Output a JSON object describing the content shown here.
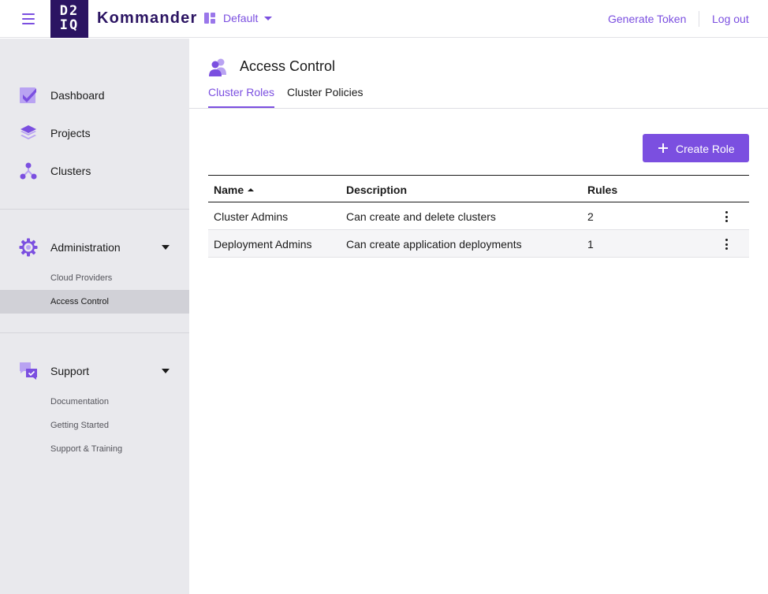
{
  "header": {
    "logo_line1": "D2",
    "logo_line2": "IQ",
    "app_name": "Kommander",
    "workspace": "Default",
    "generate_token": "Generate Token",
    "logout": "Log out"
  },
  "sidebar": {
    "items": [
      {
        "label": "Dashboard",
        "icon": "dashboard-icon"
      },
      {
        "label": "Projects",
        "icon": "projects-icon"
      },
      {
        "label": "Clusters",
        "icon": "clusters-icon"
      }
    ],
    "administration": {
      "label": "Administration",
      "icon": "gear-icon",
      "children": [
        "Cloud Providers",
        "Access Control"
      ],
      "active_child": "Access Control"
    },
    "support": {
      "label": "Support",
      "icon": "support-chat-icon",
      "children": [
        "Documentation",
        "Getting Started",
        "Support & Training"
      ]
    }
  },
  "main": {
    "title": "Access Control",
    "tabs": [
      {
        "label": "Cluster Roles",
        "active": true
      },
      {
        "label": "Cluster Policies",
        "active": false
      }
    ],
    "create_button": "Create Role",
    "table": {
      "columns": [
        "Name",
        "Description",
        "Rules"
      ],
      "sorted_by": "Name",
      "rows": [
        {
          "name": "Cluster Admins",
          "description": "Can create and delete clusters",
          "rules": "2"
        },
        {
          "name": "Deployment Admins",
          "description": "Can create application deployments",
          "rules": "1"
        }
      ]
    }
  },
  "colors": {
    "accent": "#7b4fe0",
    "brand_dark": "#2b1462",
    "sidebar_bg": "#e9e9ed",
    "active_sidebar_bg": "#d1d1d7"
  }
}
